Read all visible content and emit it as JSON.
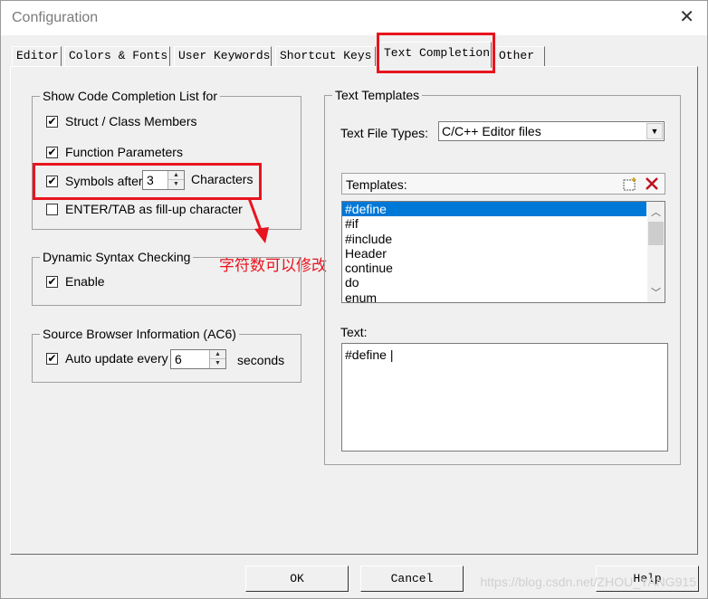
{
  "window": {
    "title": "Configuration",
    "close_glyph": "✕"
  },
  "tabs": [
    {
      "label": "Editor"
    },
    {
      "label": "Colors & Fonts"
    },
    {
      "label": "User Keywords"
    },
    {
      "label": "Shortcut Keys"
    },
    {
      "label": "Text Completion",
      "active": true
    },
    {
      "label": "Other"
    }
  ],
  "code_completion": {
    "label": "Show Code Completion List for",
    "struct_members": {
      "label": "Struct / Class Members",
      "checked": true
    },
    "function_params": {
      "label": "Function Parameters",
      "checked": true
    },
    "symbols_after": {
      "label": "Symbols after",
      "value": "3",
      "suffix": "Characters",
      "checked": true
    },
    "enter_tab": {
      "label": "ENTER/TAB as fill-up character",
      "checked": false
    }
  },
  "dynamic_syntax": {
    "label": "Dynamic Syntax Checking",
    "enable": {
      "label": "Enable",
      "checked": true
    }
  },
  "source_browser": {
    "label": "Source Browser Information (AC6)",
    "auto_update": {
      "label": "Auto update every",
      "value": "6",
      "suffix": "seconds",
      "checked": true
    }
  },
  "text_templates": {
    "label": "Text Templates",
    "file_types_label": "Text File Types:",
    "file_types_value": "C/C++ Editor files",
    "templates_label": "Templates:",
    "templates": [
      "#define",
      "#if",
      "#include",
      "Header",
      "continue",
      "do",
      "enum"
    ],
    "selected_index": 0,
    "text_label": "Text:",
    "text_value": "#define |"
  },
  "buttons": {
    "ok": "OK",
    "cancel": "Cancel",
    "help": "Help"
  },
  "annotation": {
    "text": "字符数可以修改",
    "color": "#e8141e"
  },
  "watermark": "https://blog.csdn.net/ZHOU_YANG915",
  "icons": {
    "check": "✔",
    "new_template": "new-template-icon",
    "delete_template": "delete-icon"
  },
  "colors": {
    "selection": "#0078d7",
    "highlight": "#e8141e"
  }
}
